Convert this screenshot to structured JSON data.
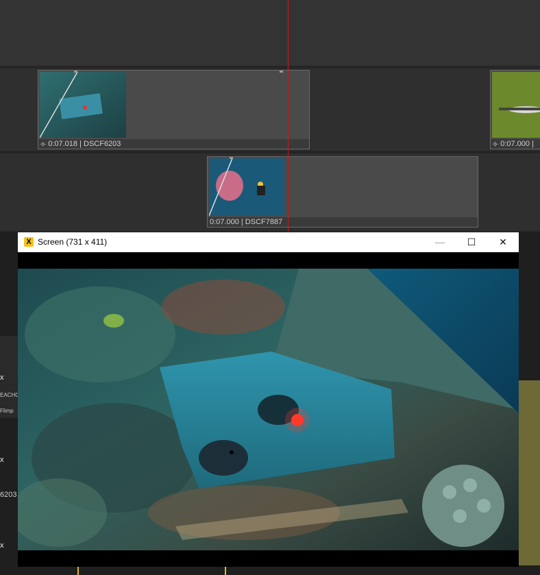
{
  "timeline": {
    "clips": [
      {
        "label": "⟣ 0:07.018 | DSCF6203"
      },
      {
        "label": "⟣ 0:07.000 |"
      },
      {
        "label": "0:07.000 | DSCF7887"
      }
    ]
  },
  "window": {
    "title": "Screen (731 x 411)",
    "app_icon_letter": "X",
    "minimize": "—",
    "maximize": "☐",
    "close": "✕"
  },
  "side_labels": {
    "left_x1": "x",
    "left_x2": "x",
    "left_x3": "x",
    "left_code": "6203",
    "left_text1": "EACHO",
    "left_text2": "Flimp"
  }
}
